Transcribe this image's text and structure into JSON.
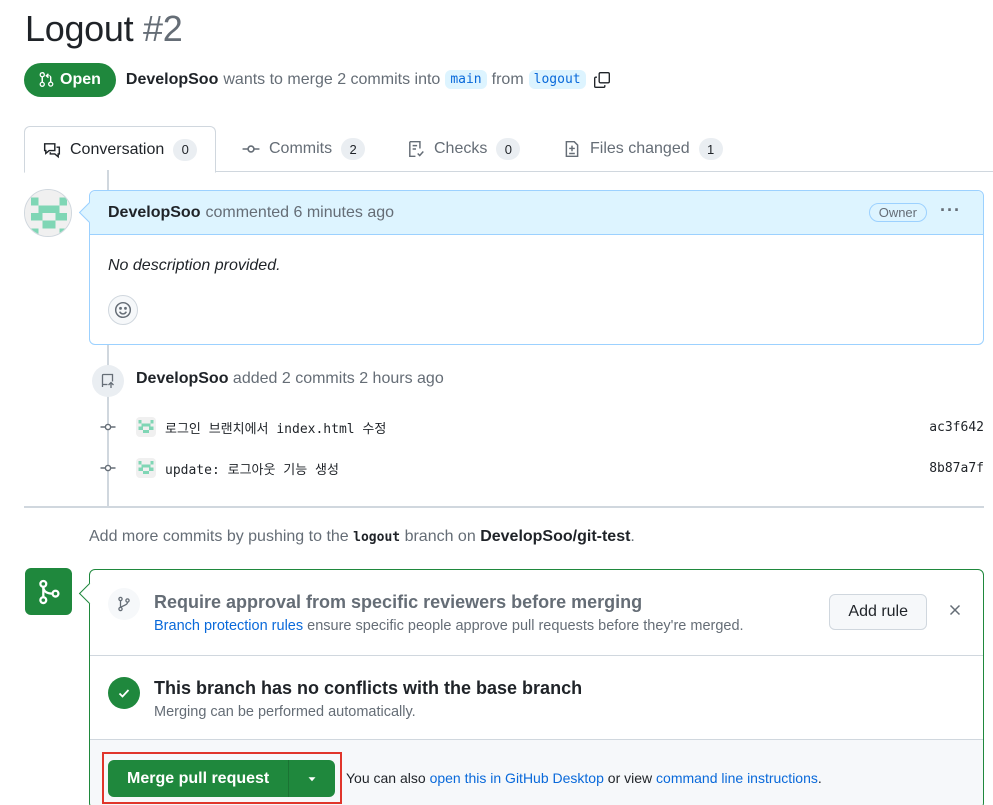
{
  "header": {
    "title": "Logout",
    "number": "#2",
    "status": "Open",
    "author": "DevelopSoo",
    "merge_text_1": "wants to merge 2 commits into",
    "base_branch": "main",
    "merge_text_2": "from",
    "head_branch": "logout"
  },
  "tabs": [
    {
      "label": "Conversation",
      "count": "0"
    },
    {
      "label": "Commits",
      "count": "2"
    },
    {
      "label": "Checks",
      "count": "0"
    },
    {
      "label": "Files changed",
      "count": "1"
    }
  ],
  "comment": {
    "author": "DevelopSoo",
    "meta": "commented 6 minutes ago",
    "role": "Owner",
    "body": "No description provided."
  },
  "commits_event": {
    "author": "DevelopSoo",
    "text": "added 2 commits 2 hours ago",
    "items": [
      {
        "message": "로그인 브랜치에서 index.html 수정",
        "sha": "ac3f642"
      },
      {
        "message": "update: 로그아웃 기능 생성",
        "sha": "8b87a7f"
      }
    ]
  },
  "hint": {
    "prefix": "Add more commits by pushing to the",
    "branch": "logout",
    "middle": "branch on",
    "repo": "DevelopSoo/git-test",
    "suffix": "."
  },
  "merge": {
    "req_title": "Require approval from specific reviewers before merging",
    "req_link": "Branch protection rules",
    "req_text": "ensure specific people approve pull requests before they're merged.",
    "add_rule": "Add rule",
    "ok_title": "This branch has no conflicts with the base branch",
    "ok_sub": "Merging can be performed automatically.",
    "merge_button": "Merge pull request",
    "also_prefix": "You can also",
    "also_link1": "open this in GitHub Desktop",
    "also_mid": "or view",
    "also_link2": "command line instructions",
    "also_suffix": "."
  },
  "colors": {
    "green": "#1f883d",
    "link": "#0969da",
    "highlight": "#e0352b"
  }
}
